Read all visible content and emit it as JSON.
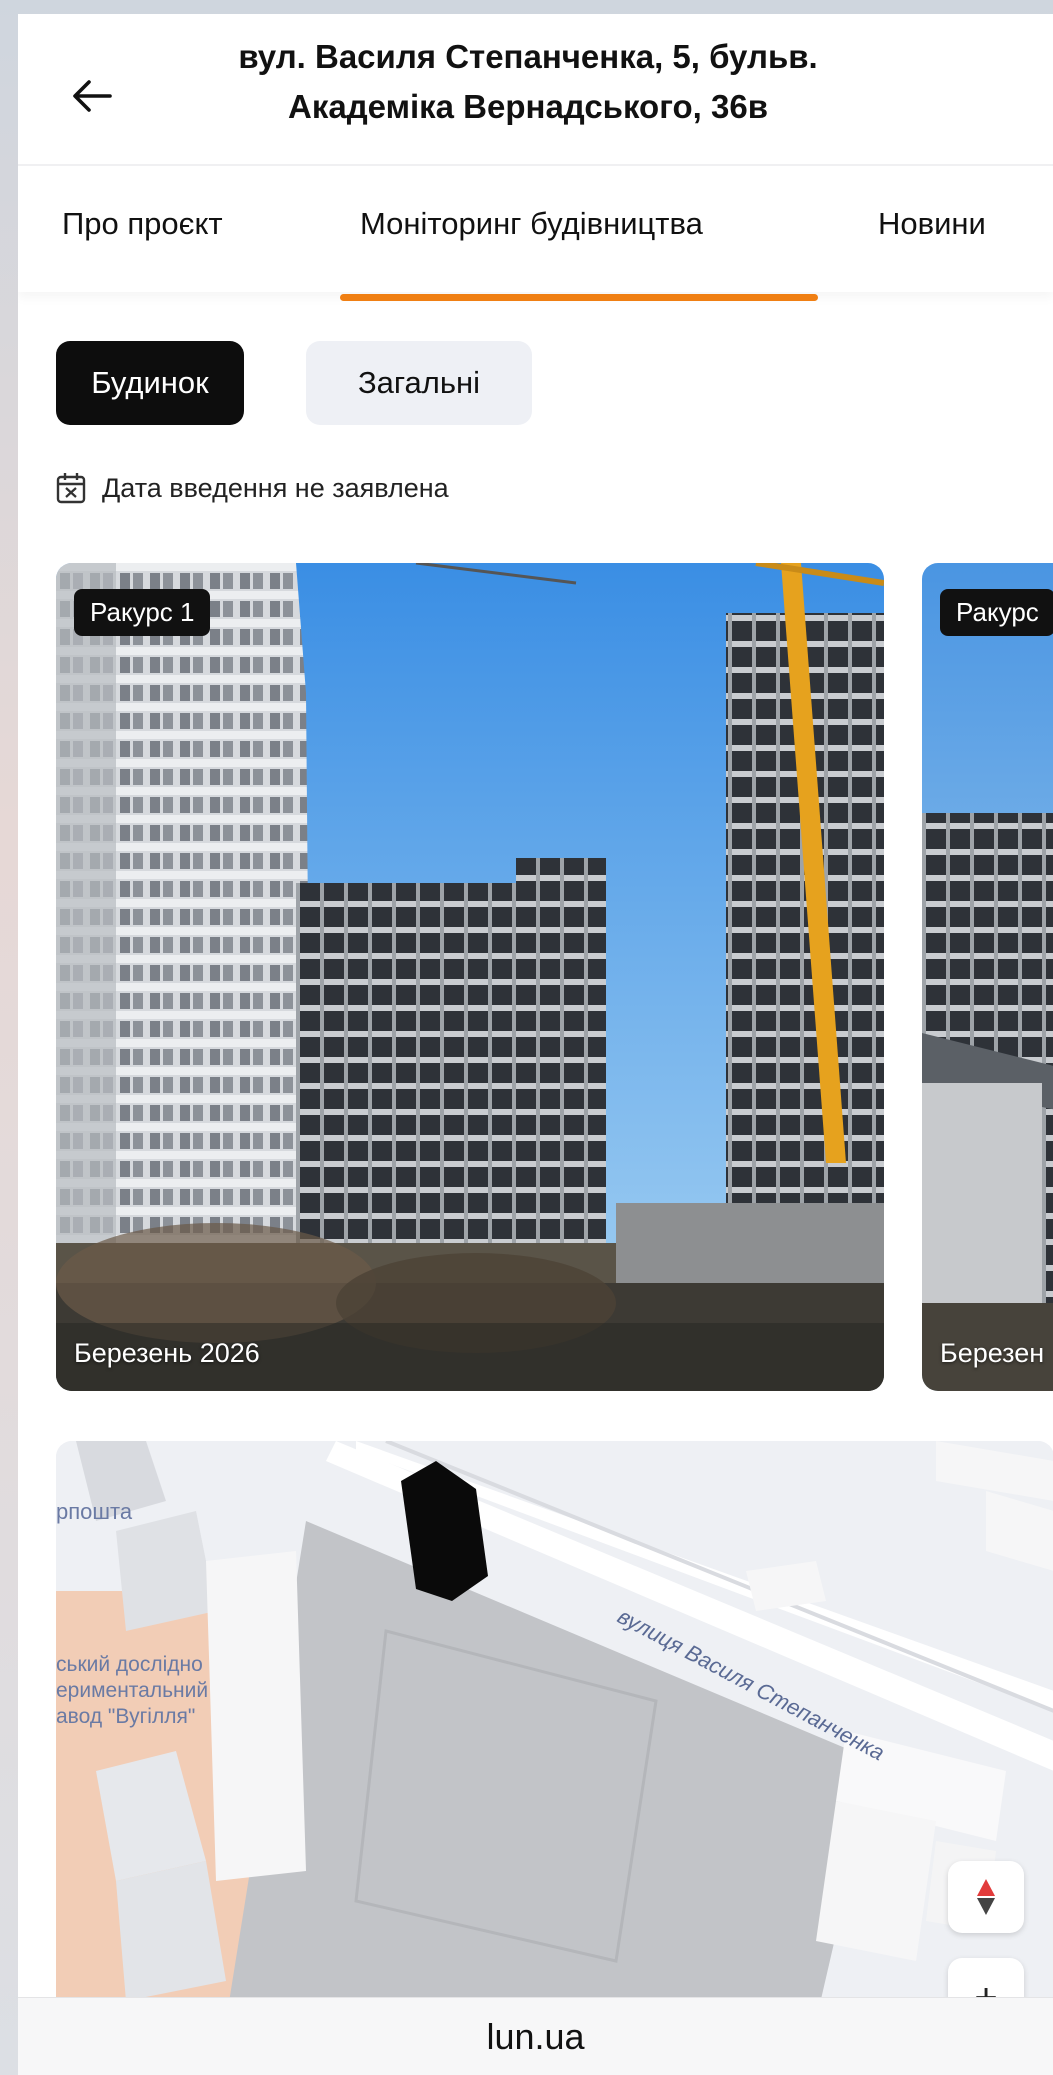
{
  "header": {
    "title_line1": "вул. Василя Степанченка, 5, бульв.",
    "title_line2": "Академіка Вернадського, 36в"
  },
  "tabs": [
    {
      "label": "Про проєкт"
    },
    {
      "label": "Моніторинг будівництва",
      "active": true
    },
    {
      "label": "Новини"
    }
  ],
  "chips": [
    {
      "label": "Будинок",
      "active": true
    },
    {
      "label": "Загальні",
      "active": false
    }
  ],
  "date_notice": "Дата введення не заявлена",
  "photos": [
    {
      "label": "Ракурс 1",
      "date": "Березень 2026"
    },
    {
      "label": "Ракурс",
      "date": "Березен"
    }
  ],
  "map": {
    "labels": {
      "street": "вулиця Василя Степанченка",
      "post": "рпошта",
      "plant_line1": "ський дослідно",
      "plant_line2": "ериментальний",
      "plant_line3": "авод \"Вугілля\""
    },
    "zoom_in": "+"
  },
  "bottom": {
    "domain": "lun.ua"
  },
  "colors": {
    "accent": "#f07f13",
    "chip_active_bg": "#0d0d0d",
    "chip_inactive_bg": "#eef0f5"
  }
}
